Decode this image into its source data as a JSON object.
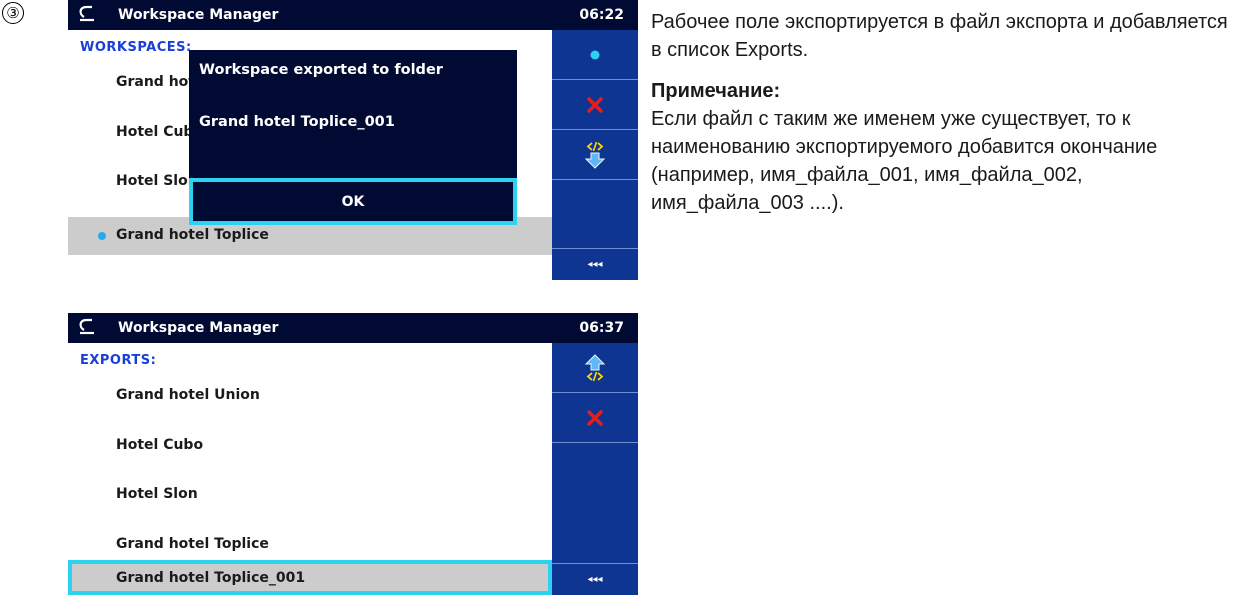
{
  "step_marker": "③",
  "screen1": {
    "title": "Workspace Manager",
    "time": "06:22",
    "heading": "WORKSPACES:",
    "items": [
      {
        "label": "Grand hotel Union"
      },
      {
        "label": "Hotel Cubo"
      },
      {
        "label": "Hotel Slon"
      },
      {
        "label": "Grand hotel Toplice"
      }
    ],
    "dialog": {
      "message": "Workspace exported to folder",
      "name": "Grand hotel Toplice_001",
      "ok_label": "OK"
    },
    "sidebar_more": "◂◂◂"
  },
  "screen2": {
    "title": "Workspace Manager",
    "time": "06:37",
    "heading": "EXPORTS:",
    "items": [
      {
        "label": "Grand hotel Union"
      },
      {
        "label": "Hotel Cubo"
      },
      {
        "label": "Hotel Slon"
      },
      {
        "label": "Grand hotel Toplice"
      },
      {
        "label": "Grand hotel Toplice_001"
      }
    ],
    "sidebar_more": "◂◂◂"
  },
  "description": {
    "text": "Рабочее поле экспортируется в файл экспорта и добавляется в список Exports.",
    "note_heading": "Примечание:",
    "note_text": "Если файл с таким же именем уже существует, то к наименованию экспортируемого добавится окончание (например, имя_файла_001, имя_файла_002, имя_файла_003 ....)."
  },
  "colors": {
    "titlebar": "#000a33",
    "sidebar": "#0f3592",
    "heading": "#1a3fd6",
    "focus": "#2bd3f0",
    "selected_row": "#cccccc",
    "delete_icon": "#e81c1c",
    "active_dot": "#25aaf0"
  }
}
